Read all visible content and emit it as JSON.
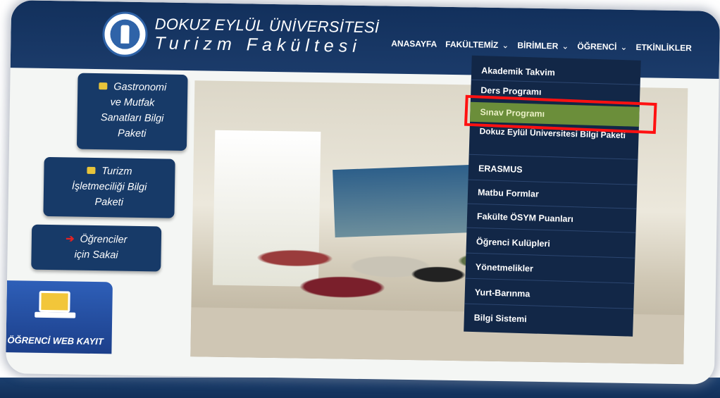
{
  "header": {
    "university": "DOKUZ EYLÜL ÜNİVERSİTESİ",
    "faculty": "Turizm Fakültesi"
  },
  "nav": {
    "items": [
      {
        "label": "ANASAYFA",
        "has_dropdown": false
      },
      {
        "label": "FAKÜLTEMİZ",
        "has_dropdown": true
      },
      {
        "label": "BİRİMLER",
        "has_dropdown": true
      },
      {
        "label": "ÖĞRENCİ",
        "has_dropdown": true
      },
      {
        "label": "ETKİNLİKLER",
        "has_dropdown": false
      }
    ],
    "caret": "⌄"
  },
  "dropdown": {
    "items": [
      "Akademik Takvim",
      "Ders Programı",
      "Sınav Programı",
      "Dokuz Eylül Üniversitesi Bilgi Paketi",
      "ERASMUS",
      "Matbu Formlar",
      "Fakülte ÖSYM Puanları",
      "Öğrenci Kulüpleri",
      "Yönetmelikler",
      "Yurt-Barınma",
      "Bilgi Sistemi"
    ],
    "active_index": 2
  },
  "sidebar": {
    "gastronomi": [
      "Gastronomi",
      "ve Mutfak",
      "Sanatları Bilgi",
      "Paketi"
    ],
    "turizm": [
      "Turizm",
      "İşletmeciliği Bilgi",
      "Paketi"
    ],
    "sakai": [
      "Öğrenciler",
      "için Sakai"
    ],
    "web_kayit": "ÖĞRENCİ WEB KAYIT"
  },
  "colors": {
    "header_bg": "#12305c",
    "dropdown_bg": "#122747",
    "active_item": "#6b8e3a",
    "highlight": "#ff1111"
  }
}
